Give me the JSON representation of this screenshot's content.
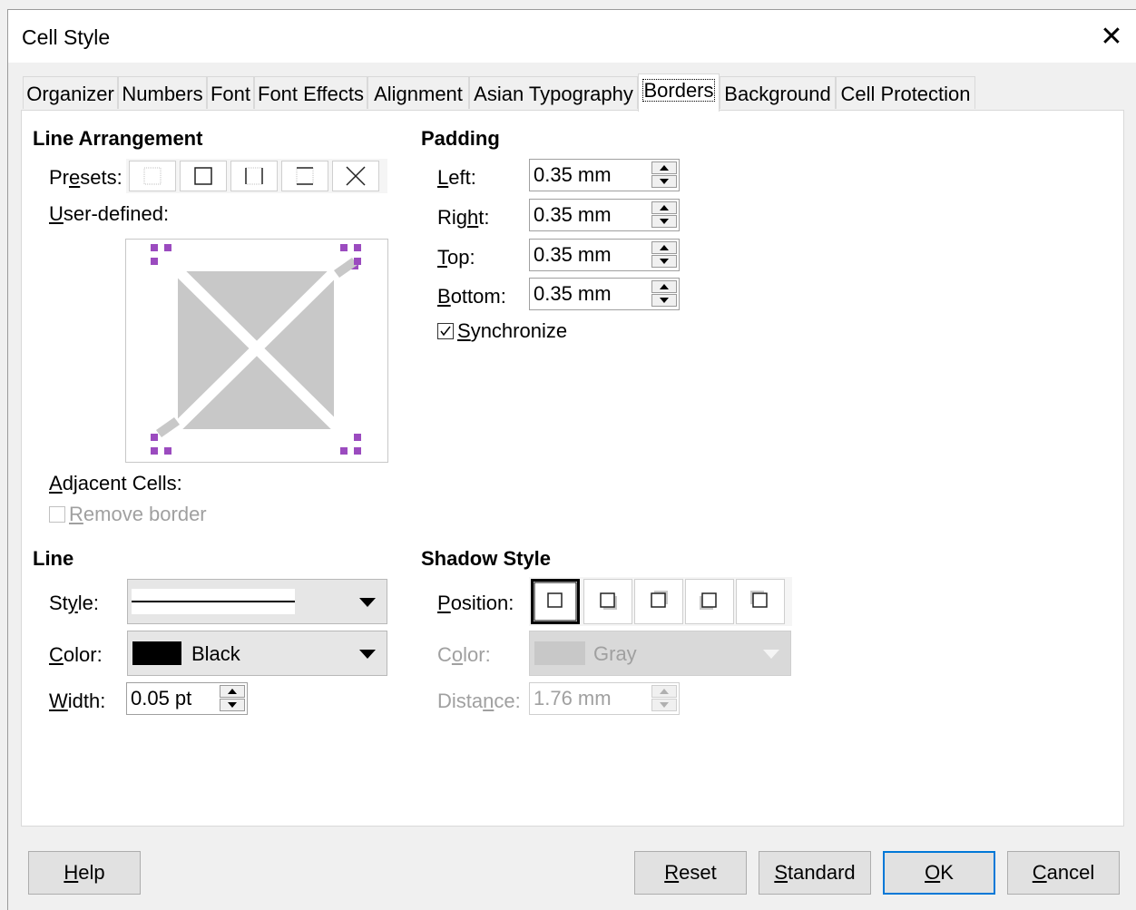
{
  "window": {
    "title": "Cell Style",
    "close": "✕"
  },
  "tabs": [
    "Organizer",
    "Numbers",
    "Font",
    "Font Effects",
    "Alignment",
    "Asian Typography",
    "Borders",
    "Background",
    "Cell Protection"
  ],
  "active_tab": "Borders",
  "line_arrangement": {
    "header": "Line Arrangement",
    "presets_label_pre": "Pr",
    "presets_label_u": "e",
    "presets_label_post": "sets:",
    "user_defined_pre": "",
    "user_defined_u": "U",
    "user_defined_post": "ser-defined:",
    "adjacent_pre": "",
    "adjacent_u": "A",
    "adjacent_post": "djacent Cells:",
    "remove_border_pre": "",
    "remove_border_u": "R",
    "remove_border_post": "emove border"
  },
  "padding": {
    "header": "Padding",
    "left_u": "L",
    "left_post": "eft:",
    "left_value": "0.35 mm",
    "right_pre": "Rig",
    "right_u": "h",
    "right_post": "t:",
    "right_value": "0.35 mm",
    "top_u": "T",
    "top_post": "op:",
    "top_value": "0.35 mm",
    "bottom_u": "B",
    "bottom_post": "ottom:",
    "bottom_value": "0.35 mm",
    "sync_u": "S",
    "sync_post": "ynchronize"
  },
  "line": {
    "header": "Line",
    "style_pre": "St",
    "style_u": "y",
    "style_post": "le:",
    "color_u": "C",
    "color_post": "olor:",
    "color_value": "Black",
    "color_swatch": "#000000",
    "width_u": "W",
    "width_post": "idth:",
    "width_value": "0.05 pt"
  },
  "shadow": {
    "header": "Shadow Style",
    "position_u": "P",
    "position_post": "osition:",
    "color_pre": "C",
    "color_u": "o",
    "color_post": "lor:",
    "color_value": "Gray",
    "color_swatch": "#c8c8c8",
    "distance_pre": "Dista",
    "distance_u": "n",
    "distance_post": "ce:",
    "distance_value": "1.76 mm"
  },
  "buttons": {
    "help_u": "H",
    "help_post": "elp",
    "reset_u": "R",
    "reset_post": "eset",
    "standard_u": "S",
    "standard_post": "tandard",
    "ok_u": "O",
    "ok_post": "K",
    "cancel_u": "C",
    "cancel_post": "ancel"
  },
  "colors": {
    "accent": "#0078d7",
    "marker": "#9b4bbf",
    "diagram_fill": "#c8c8c8"
  }
}
